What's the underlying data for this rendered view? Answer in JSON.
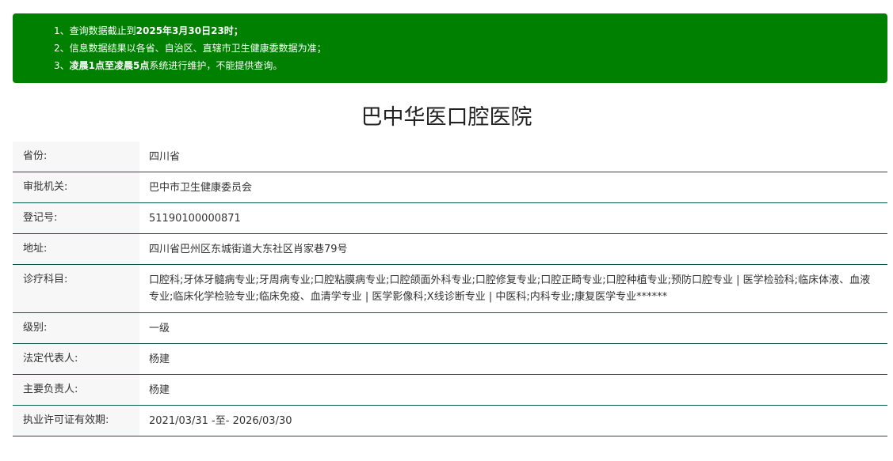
{
  "notice": {
    "line1_a": "1、查询数据截止到",
    "line1_b": "2025年3月30日23时；",
    "line2": "2、信息数据结果以各省、自治区、直辖市卫生健康委数据为准；",
    "line3_a": "3、",
    "line3_b": "凌晨1点至凌晨5点",
    "line3_c": "系统进行维护，不能提供查询。",
    "bg_color": "#008000"
  },
  "title": "巴中华医口腔医院",
  "rows": [
    {
      "label": "省份:",
      "value": "四川省"
    },
    {
      "label": "审批机关:",
      "value": "巴中市卫生健康委员会"
    },
    {
      "label": "登记号:",
      "value": "51190100000871"
    },
    {
      "label": "地址:",
      "value": "四川省巴州区东城街道大东社区肖家巷79号"
    },
    {
      "label": "诊疗科目:",
      "value": "口腔科;牙体牙髓病专业;牙周病专业;口腔粘膜病专业;口腔颌面外科专业;口腔修复专业;口腔正畸专业;口腔种植专业;预防口腔专业 | 医学检验科;临床体液、血液专业;临床化学检验专业;临床免疫、血清学专业 | 医学影像科;X线诊断专业 | 中医科;内科专业;康复医学专业******"
    },
    {
      "label": "级别:",
      "value": "一级"
    },
    {
      "label": "法定代表人:",
      "value": "杨建"
    },
    {
      "label": "主要负责人:",
      "value": "杨建"
    },
    {
      "label": "执业许可证有效期:",
      "value": "2021/03/31 -至- 2026/03/30"
    }
  ],
  "colors": {
    "border": "#0b5a4a",
    "label_bg": "#f7f7f7"
  }
}
